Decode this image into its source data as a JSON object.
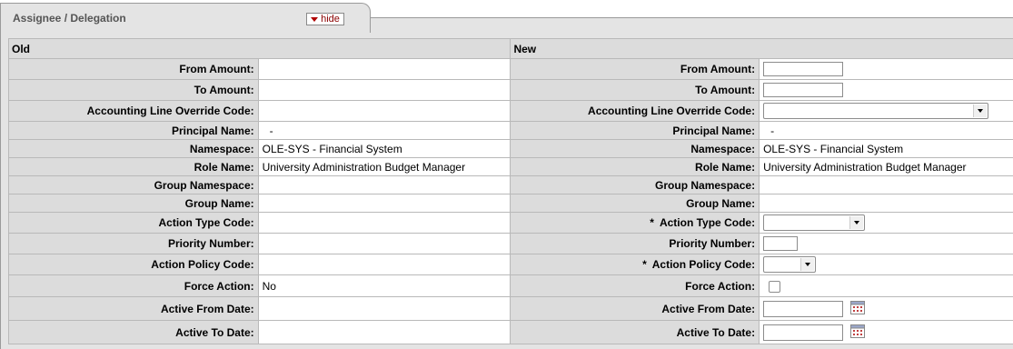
{
  "panel": {
    "title": "Assignee / Delegation",
    "hide_label": "hide"
  },
  "sections": {
    "old": "Old",
    "new": "New"
  },
  "labels": {
    "from_amount": "From Amount:",
    "to_amount": "To Amount:",
    "accounting_line_override_code": "Accounting Line Override Code:",
    "principal_name": "Principal Name:",
    "namespace": "Namespace:",
    "role_name": "Role Name:",
    "group_namespace": "Group Namespace:",
    "group_name": "Group Name:",
    "action_type_code": "Action Type Code:",
    "priority_number": "Priority Number:",
    "action_policy_code": "Action Policy Code:",
    "force_action": "Force Action:",
    "active_from_date": "Active From Date:",
    "active_to_date": "Active To Date:"
  },
  "required_marker": "*",
  "old": {
    "from_amount": "",
    "to_amount": "",
    "accounting_line_override_code": "",
    "principal_name": "-",
    "namespace": "OLE-SYS - Financial System",
    "role_name": "University Administration Budget Manager",
    "group_namespace": "",
    "group_name": "",
    "action_type_code": "",
    "priority_number": "",
    "action_policy_code": "",
    "force_action": "No",
    "active_from_date": "",
    "active_to_date": ""
  },
  "new": {
    "from_amount": "",
    "to_amount": "",
    "accounting_line_override_code": "",
    "principal_name": "-",
    "namespace": "OLE-SYS - Financial System",
    "role_name": "University Administration Budget Manager",
    "group_namespace": "",
    "group_name": "",
    "action_type_code": "",
    "priority_number": "",
    "action_policy_code": "",
    "force_action_checked": false,
    "active_from_date": "",
    "active_to_date": ""
  },
  "icons": {
    "hide": "triangle-down-icon",
    "calendar": "calendar-icon"
  },
  "colors": {
    "hide_text": "#8b0000",
    "label_bg": "#dcdcdc",
    "panel_bg": "#e4e4e4"
  }
}
